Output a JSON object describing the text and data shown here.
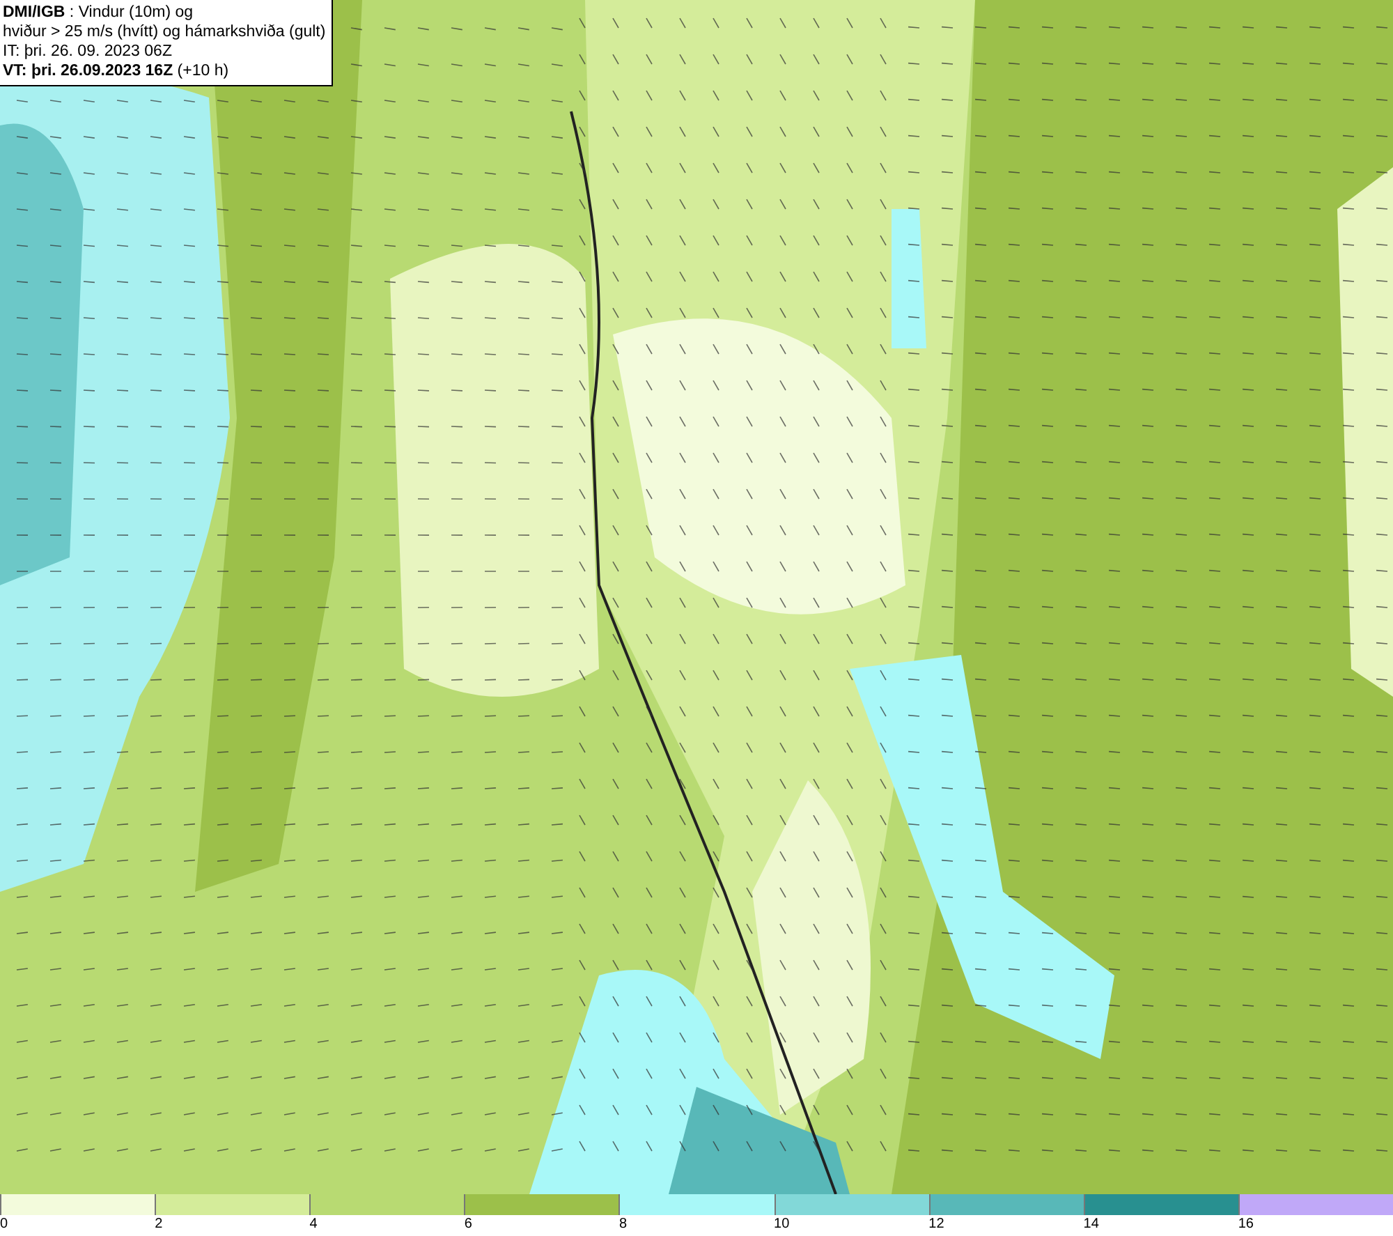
{
  "header": {
    "lines": [
      "**DMI/IGB** : Vindur (10m) og",
      "hviður > 25 m/s (hvítt) og hámarkshviða (gult)",
      "IT: þri. 26. 09. 2023 06Z",
      "**VT: þri. 26.09.2023 16Z** (+10 h)"
    ]
  },
  "legend": [
    {
      "label": "0",
      "color": "#f3fbdc"
    },
    {
      "label": "2",
      "color": "#d4ec9a"
    },
    {
      "label": "4",
      "color": "#b8da72"
    },
    {
      "label": "6",
      "color": "#9cc04a"
    },
    {
      "label": "8",
      "color": "#a8f8f8"
    },
    {
      "label": "10",
      "color": "#82d8d8"
    },
    {
      "label": "12",
      "color": "#58b8b8"
    },
    {
      "label": "14",
      "color": "#289090"
    },
    {
      "label": "16",
      "color": "#c0a8f8"
    }
  ]
}
